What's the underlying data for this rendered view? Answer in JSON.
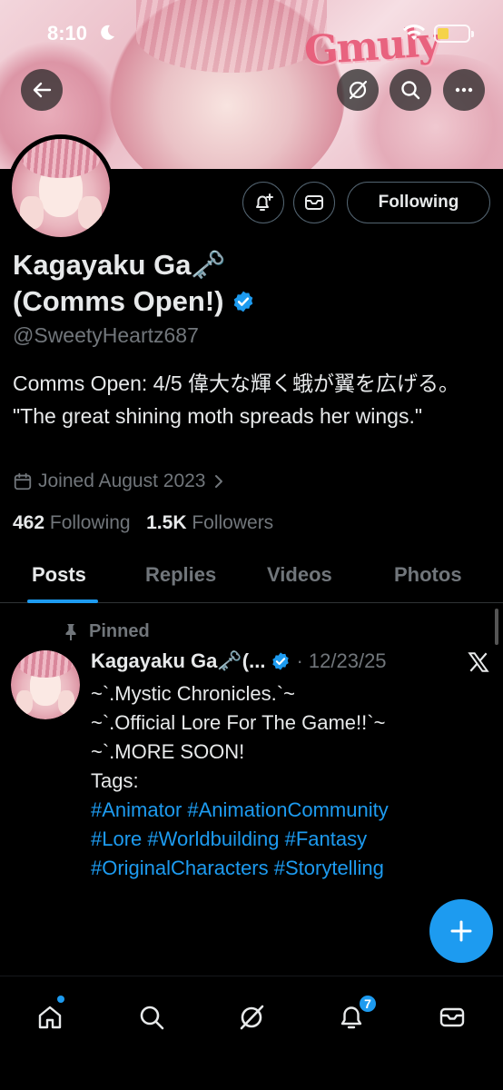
{
  "status_bar": {
    "time": "8:10"
  },
  "banner": {
    "logo_text": "Gmuly"
  },
  "profile": {
    "name_line1": "Kagayaku Ga🗝️",
    "name_line2": "(Comms Open!)",
    "handle": "@SweetyHeartz687",
    "bio": "Comms Open: 4/5 偉大な輝く蛾が翼を広げる。 \"The great shining moth spreads her wings.\"",
    "joined": "Joined August 2023",
    "following_count": "462",
    "following_label": "Following",
    "followers_count": "1.5K",
    "followers_label": "Followers",
    "follow_button": "Following"
  },
  "tabs": [
    "Posts",
    "Replies",
    "Videos",
    "Photos"
  ],
  "post": {
    "pinned_label": "Pinned",
    "author": "Kagayaku Ga🗝️(...",
    "date": "· 12/23/25",
    "lines": [
      "~`.Mystic Chronicles.`~",
      "",
      "~`.Official Lore For The Game!!`~",
      "",
      "~`.MORE SOON!",
      "",
      "Tags:"
    ],
    "hashtag_lines": [
      "#Animator #AnimationCommunity",
      "#Lore #Worldbuilding #Fantasy",
      "#OriginalCharacters #Storytelling"
    ]
  },
  "bottom_nav": {
    "notification_count": "7"
  },
  "colors": {
    "accent": "#1d9bf0",
    "muted": "#71767b",
    "text": "#e7e9ea",
    "background": "#000000"
  }
}
